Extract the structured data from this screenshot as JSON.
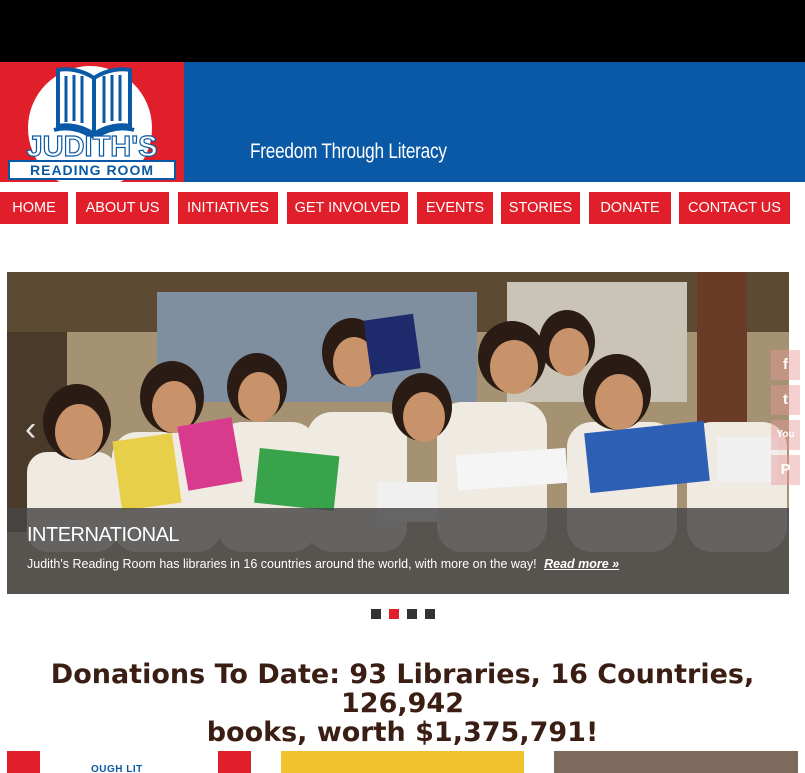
{
  "logo": {
    "title": "JUDITH'S",
    "subtitle": "READING ROOM"
  },
  "header": {
    "tagline": "Freedom Through Literacy"
  },
  "nav": {
    "items": [
      "HOME",
      "ABOUT US",
      "INITIATIVES",
      "GET INVOLVED",
      "EVENTS",
      "STORIES",
      "DONATE",
      "CONTACT US"
    ]
  },
  "slider": {
    "caption_title": "INTERNATIONAL",
    "caption_text": "Judith's Reading Room has libraries in 16 countries around the world, with more on the way!",
    "caption_link": "Read more »",
    "prev_arrow": "‹",
    "active_dot": 2,
    "dot_count": 4
  },
  "social": {
    "icons": [
      "facebook-icon",
      "twitter-icon",
      "youtube-icon",
      "pinterest-icon"
    ],
    "glyphs": [
      "f",
      "t",
      "You",
      "P"
    ]
  },
  "donations": {
    "line1": "Donations To Date: 93 Libraries, 16 Countries, 126,942",
    "line2": "books, worth $1,375,791!"
  },
  "tiles": {
    "tile1_label": "OUGH LIT"
  },
  "colors": {
    "brand_red": "#e01f2a",
    "brand_blue": "#0a59a6",
    "heading_brown": "#3a1e14"
  }
}
